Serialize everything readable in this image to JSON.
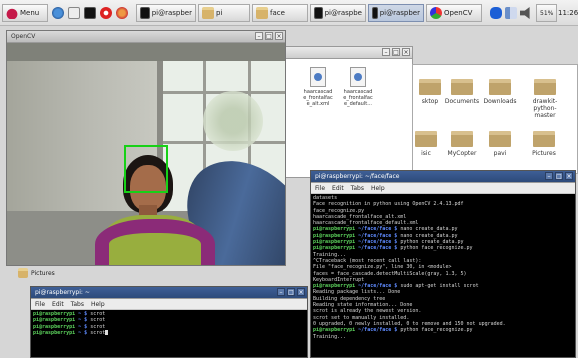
{
  "taskbar": {
    "menu_label": "Menu",
    "buttons": [
      {
        "label": "pi@raspber",
        "icon": "terminal-icon"
      },
      {
        "label": "pi",
        "icon": "folder-icon"
      },
      {
        "label": "face",
        "icon": "folder-icon"
      },
      {
        "label": "pi@raspbe",
        "icon": "terminal-icon"
      },
      {
        "label": "pi@raspber",
        "icon": "terminal-icon"
      },
      {
        "label": "OpenCV",
        "icon": "opencv-icon"
      }
    ],
    "tray_percent": "51%",
    "clock": "11:26"
  },
  "opencv_window": {
    "title": "OpenCV",
    "face_box_color": "#17d117"
  },
  "file_manager": {
    "files": [
      {
        "name": "haarcascade_frontalface_alt.xml"
      },
      {
        "name": "haarcascade_frontalface_default.xml"
      }
    ],
    "partial_visible_names": [
      "haarcascad\ne_frontalfac\ne_alt.xml",
      "haarcascad\ne_frontalfac\ne_default..."
    ]
  },
  "home_window": {
    "folders": [
      "sktop",
      "Documents",
      "Downloads",
      "drawkit-python-master",
      "isic",
      "MyCopter",
      "pavi",
      "Pictures"
    ]
  },
  "desktop": {
    "items": [
      "Pictures"
    ]
  },
  "terminal_main": {
    "title": "pi@raspberrypi: ~/face/face",
    "menu": [
      "File",
      "Edit",
      "Tabs",
      "Help"
    ],
    "lines": [
      {
        "text": "datasets"
      },
      {
        "text": "Face recognition in python using OpenCV 2.4.13.pdf"
      },
      {
        "text": "face_recognize.py"
      },
      {
        "text": "haarcascade_frontalface_alt.xml"
      },
      {
        "text": "haarcascade_frontalface_default.xml"
      },
      {
        "user": "pi@raspberrypi",
        "path": "~/face/face $",
        "cmd": " nano create_data.py"
      },
      {
        "user": "pi@raspberrypi",
        "path": "~/face/face $",
        "cmd": " nano create_data.py"
      },
      {
        "user": "pi@raspberrypi",
        "path": "~/face/face $",
        "cmd": " python create_data.py"
      },
      {
        "user": "pi@raspberrypi",
        "path": "~/face/face $",
        "cmd": " python face_recognize.py"
      },
      {
        "text": "Training..."
      },
      {
        "text": "^CTraceback (most recent call last):"
      },
      {
        "text": "  File \"face_recognize.py\", line 30, in <module>"
      },
      {
        "text": "    faces = face_cascade.detectMultiScale(gray, 1.3, 5)"
      },
      {
        "text": "KeyboardInterrupt"
      },
      {
        "user": "pi@raspberrypi",
        "path": "~/face/face $",
        "cmd": " sudo apt-get install scrot"
      },
      {
        "text": "Reading package lists... Done"
      },
      {
        "text": "Building dependency tree"
      },
      {
        "text": "Reading state information... Done"
      },
      {
        "text": "scrot is already the newest version."
      },
      {
        "text": "scrot set to manually installed."
      },
      {
        "text": "0 upgraded, 0 newly installed, 0 to remove and 150 not upgraded."
      },
      {
        "user": "pi@raspberrypi",
        "path": "~/face/face $",
        "cmd": " python face_recognize.py"
      },
      {
        "text": "Training..."
      }
    ]
  },
  "terminal_small": {
    "title": "pi@raspberrypi: ~",
    "menu": [
      "File",
      "Edit",
      "Tabs",
      "Help"
    ],
    "lines": [
      {
        "user": "pi@raspberrypi",
        "path": "~ $",
        "cmd": " scrot"
      },
      {
        "user": "pi@raspberrypi",
        "path": "~ $",
        "cmd": " scrot"
      },
      {
        "user": "pi@raspberrypi",
        "path": "~ $",
        "cmd": " scrot"
      },
      {
        "user": "pi@raspberrypi",
        "path": "~ $",
        "cmd": " scrot"
      }
    ]
  }
}
